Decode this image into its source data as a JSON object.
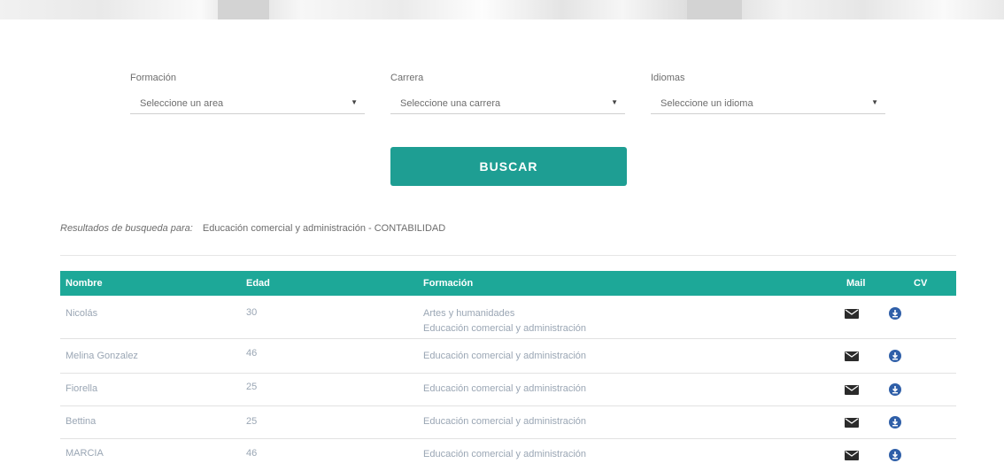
{
  "filters": {
    "formacion": {
      "label": "Formación",
      "value": "Seleccione un area"
    },
    "carrera": {
      "label": "Carrera",
      "value": "Seleccione una carrera"
    },
    "idiomas": {
      "label": "Idiomas",
      "value": "Seleccione un idioma"
    }
  },
  "search_button": "BUSCAR",
  "results": {
    "prefix": "Resultados de busqueda para:",
    "query": "Educación comercial y administración - CONTABILIDAD"
  },
  "table": {
    "headers": {
      "nombre": "Nombre",
      "edad": "Edad",
      "formacion": "Formación",
      "mail": "Mail",
      "cv": "CV"
    },
    "rows": [
      {
        "nombre": "Nicolás",
        "edad": "30",
        "formacion": [
          "Artes y humanidades",
          "Educación comercial y administración"
        ]
      },
      {
        "nombre": "Melina Gonzalez",
        "edad": "46",
        "formacion": [
          "Educación comercial y administración"
        ]
      },
      {
        "nombre": "Fiorella",
        "edad": "25",
        "formacion": [
          "Educación comercial y administración"
        ]
      },
      {
        "nombre": "Bettina",
        "edad": "25",
        "formacion": [
          "Educación comercial y administración"
        ]
      },
      {
        "nombre": "MARCIA",
        "edad": "46",
        "formacion": [
          "Educación comercial y administración"
        ]
      }
    ]
  },
  "icons": {
    "mail": "envelope-icon",
    "cv": "download-icon"
  },
  "colors": {
    "accent": "#1e9e93",
    "header": "#1da898",
    "link": "#9aa6b4",
    "cv_icon": "#2f5fa8"
  }
}
